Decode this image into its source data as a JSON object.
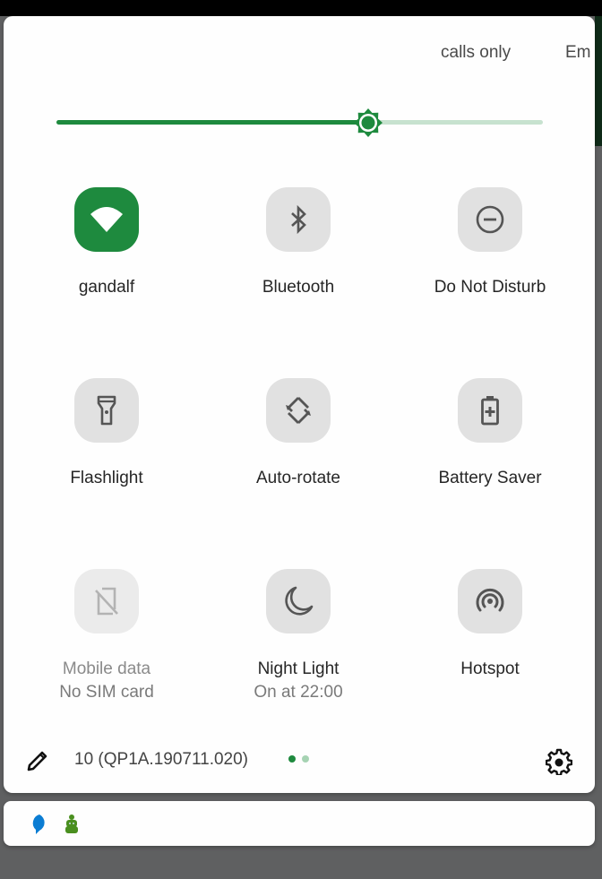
{
  "status_header": {
    "dnd_mode_text": "calls only",
    "truncated_text": "Em"
  },
  "brightness": {
    "level_percent": 64,
    "icon": "brightness-icon"
  },
  "tiles": [
    {
      "id": "wifi",
      "label": "gandalf",
      "sublabel": "",
      "icon": "wifi-icon",
      "state": "active"
    },
    {
      "id": "bluetooth",
      "label": "Bluetooth",
      "sublabel": "",
      "icon": "bluetooth-icon",
      "state": "inactive"
    },
    {
      "id": "dnd",
      "label": "Do Not Disturb",
      "sublabel": "",
      "icon": "do-not-disturb-icon",
      "state": "inactive"
    },
    {
      "id": "flashlight",
      "label": "Flashlight",
      "sublabel": "",
      "icon": "flashlight-icon",
      "state": "inactive"
    },
    {
      "id": "autorotate",
      "label": "Auto-rotate",
      "sublabel": "",
      "icon": "auto-rotate-icon",
      "state": "inactive"
    },
    {
      "id": "battery",
      "label": "Battery Saver",
      "sublabel": "",
      "icon": "battery-saver-icon",
      "state": "inactive"
    },
    {
      "id": "mobiledata",
      "label": "Mobile data",
      "sublabel": "No SIM card",
      "icon": "no-sim-icon",
      "state": "disabled"
    },
    {
      "id": "nightlight",
      "label": "Night Light",
      "sublabel": "On at 22:00",
      "icon": "night-light-icon",
      "state": "inactive"
    },
    {
      "id": "hotspot",
      "label": "Hotspot",
      "sublabel": "",
      "icon": "hotspot-icon",
      "state": "inactive"
    }
  ],
  "footer": {
    "build_number": "10 (QP1A.190711.020)",
    "page_count": 2,
    "current_page": 1
  },
  "notifications": {
    "icons": [
      "messages-icon",
      "android-icon"
    ]
  },
  "colors": {
    "accent": "#1e8a3e",
    "accent_light": "#c7e2cf",
    "tile_inactive": "#e1e1e1",
    "messages_blue": "#0b7dd3",
    "android_green": "#4a8f1f"
  }
}
